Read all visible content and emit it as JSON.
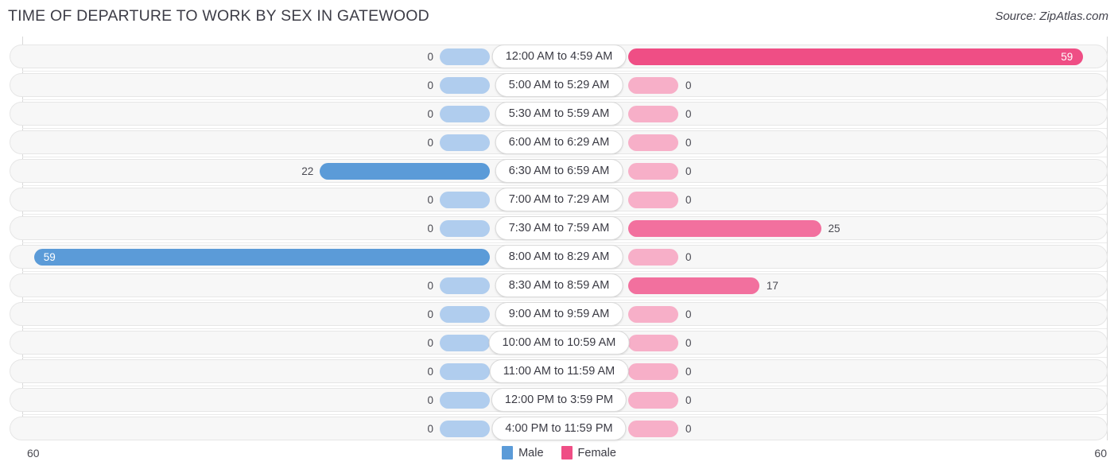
{
  "header": {
    "title": "TIME OF DEPARTURE TO WORK BY SEX IN GATEWOOD",
    "source": "Source: ZipAtlas.com"
  },
  "legend": {
    "items": [
      {
        "label": "Male",
        "color": "#5b9bd8"
      },
      {
        "label": "Female",
        "color": "#ef4e85"
      }
    ]
  },
  "axis": {
    "left_max": "60",
    "right_max": "60"
  },
  "colors": {
    "male_strong": "#5b9bd8",
    "male_light": "#b0cdee",
    "female_strong": "#ef4e85",
    "female_mid": "#f2709e",
    "female_light": "#f7afc8",
    "track": "#f7f7f7",
    "title": "#3d3d47"
  },
  "chart_data": {
    "type": "bar",
    "orientation": "horizontal-diverging",
    "title": "TIME OF DEPARTURE TO WORK BY SEX IN GATEWOOD",
    "xlabel": "",
    "ylabel": "",
    "xlim": [
      0,
      60
    ],
    "grid": false,
    "legend_position": "bottom-center",
    "categories": [
      "12:00 AM to 4:59 AM",
      "5:00 AM to 5:29 AM",
      "5:30 AM to 5:59 AM",
      "6:00 AM to 6:29 AM",
      "6:30 AM to 6:59 AM",
      "7:00 AM to 7:29 AM",
      "7:30 AM to 7:59 AM",
      "8:00 AM to 8:29 AM",
      "8:30 AM to 8:59 AM",
      "9:00 AM to 9:59 AM",
      "10:00 AM to 10:59 AM",
      "11:00 AM to 11:59 AM",
      "12:00 PM to 3:59 PM",
      "4:00 PM to 11:59 PM"
    ],
    "series": [
      {
        "name": "Male",
        "values": [
          0,
          0,
          0,
          0,
          22,
          0,
          0,
          59,
          0,
          0,
          0,
          0,
          0,
          0
        ]
      },
      {
        "name": "Female",
        "values": [
          59,
          0,
          0,
          0,
          0,
          0,
          25,
          0,
          17,
          0,
          0,
          0,
          0,
          0
        ]
      }
    ]
  },
  "rows": [
    {
      "category": "12:00 AM to 4:59 AM",
      "male": "0",
      "female": "59"
    },
    {
      "category": "5:00 AM to 5:29 AM",
      "male": "0",
      "female": "0"
    },
    {
      "category": "5:30 AM to 5:59 AM",
      "male": "0",
      "female": "0"
    },
    {
      "category": "6:00 AM to 6:29 AM",
      "male": "0",
      "female": "0"
    },
    {
      "category": "6:30 AM to 6:59 AM",
      "male": "22",
      "female": "0"
    },
    {
      "category": "7:00 AM to 7:29 AM",
      "male": "0",
      "female": "0"
    },
    {
      "category": "7:30 AM to 7:59 AM",
      "male": "0",
      "female": "25"
    },
    {
      "category": "8:00 AM to 8:29 AM",
      "male": "59",
      "female": "0"
    },
    {
      "category": "8:30 AM to 8:59 AM",
      "male": "0",
      "female": "17"
    },
    {
      "category": "9:00 AM to 9:59 AM",
      "male": "0",
      "female": "0"
    },
    {
      "category": "10:00 AM to 10:59 AM",
      "male": "0",
      "female": "0"
    },
    {
      "category": "11:00 AM to 11:59 AM",
      "male": "0",
      "female": "0"
    },
    {
      "category": "12:00 PM to 3:59 PM",
      "male": "0",
      "female": "0"
    },
    {
      "category": "4:00 PM to 11:59 PM",
      "male": "0",
      "female": "0"
    }
  ]
}
